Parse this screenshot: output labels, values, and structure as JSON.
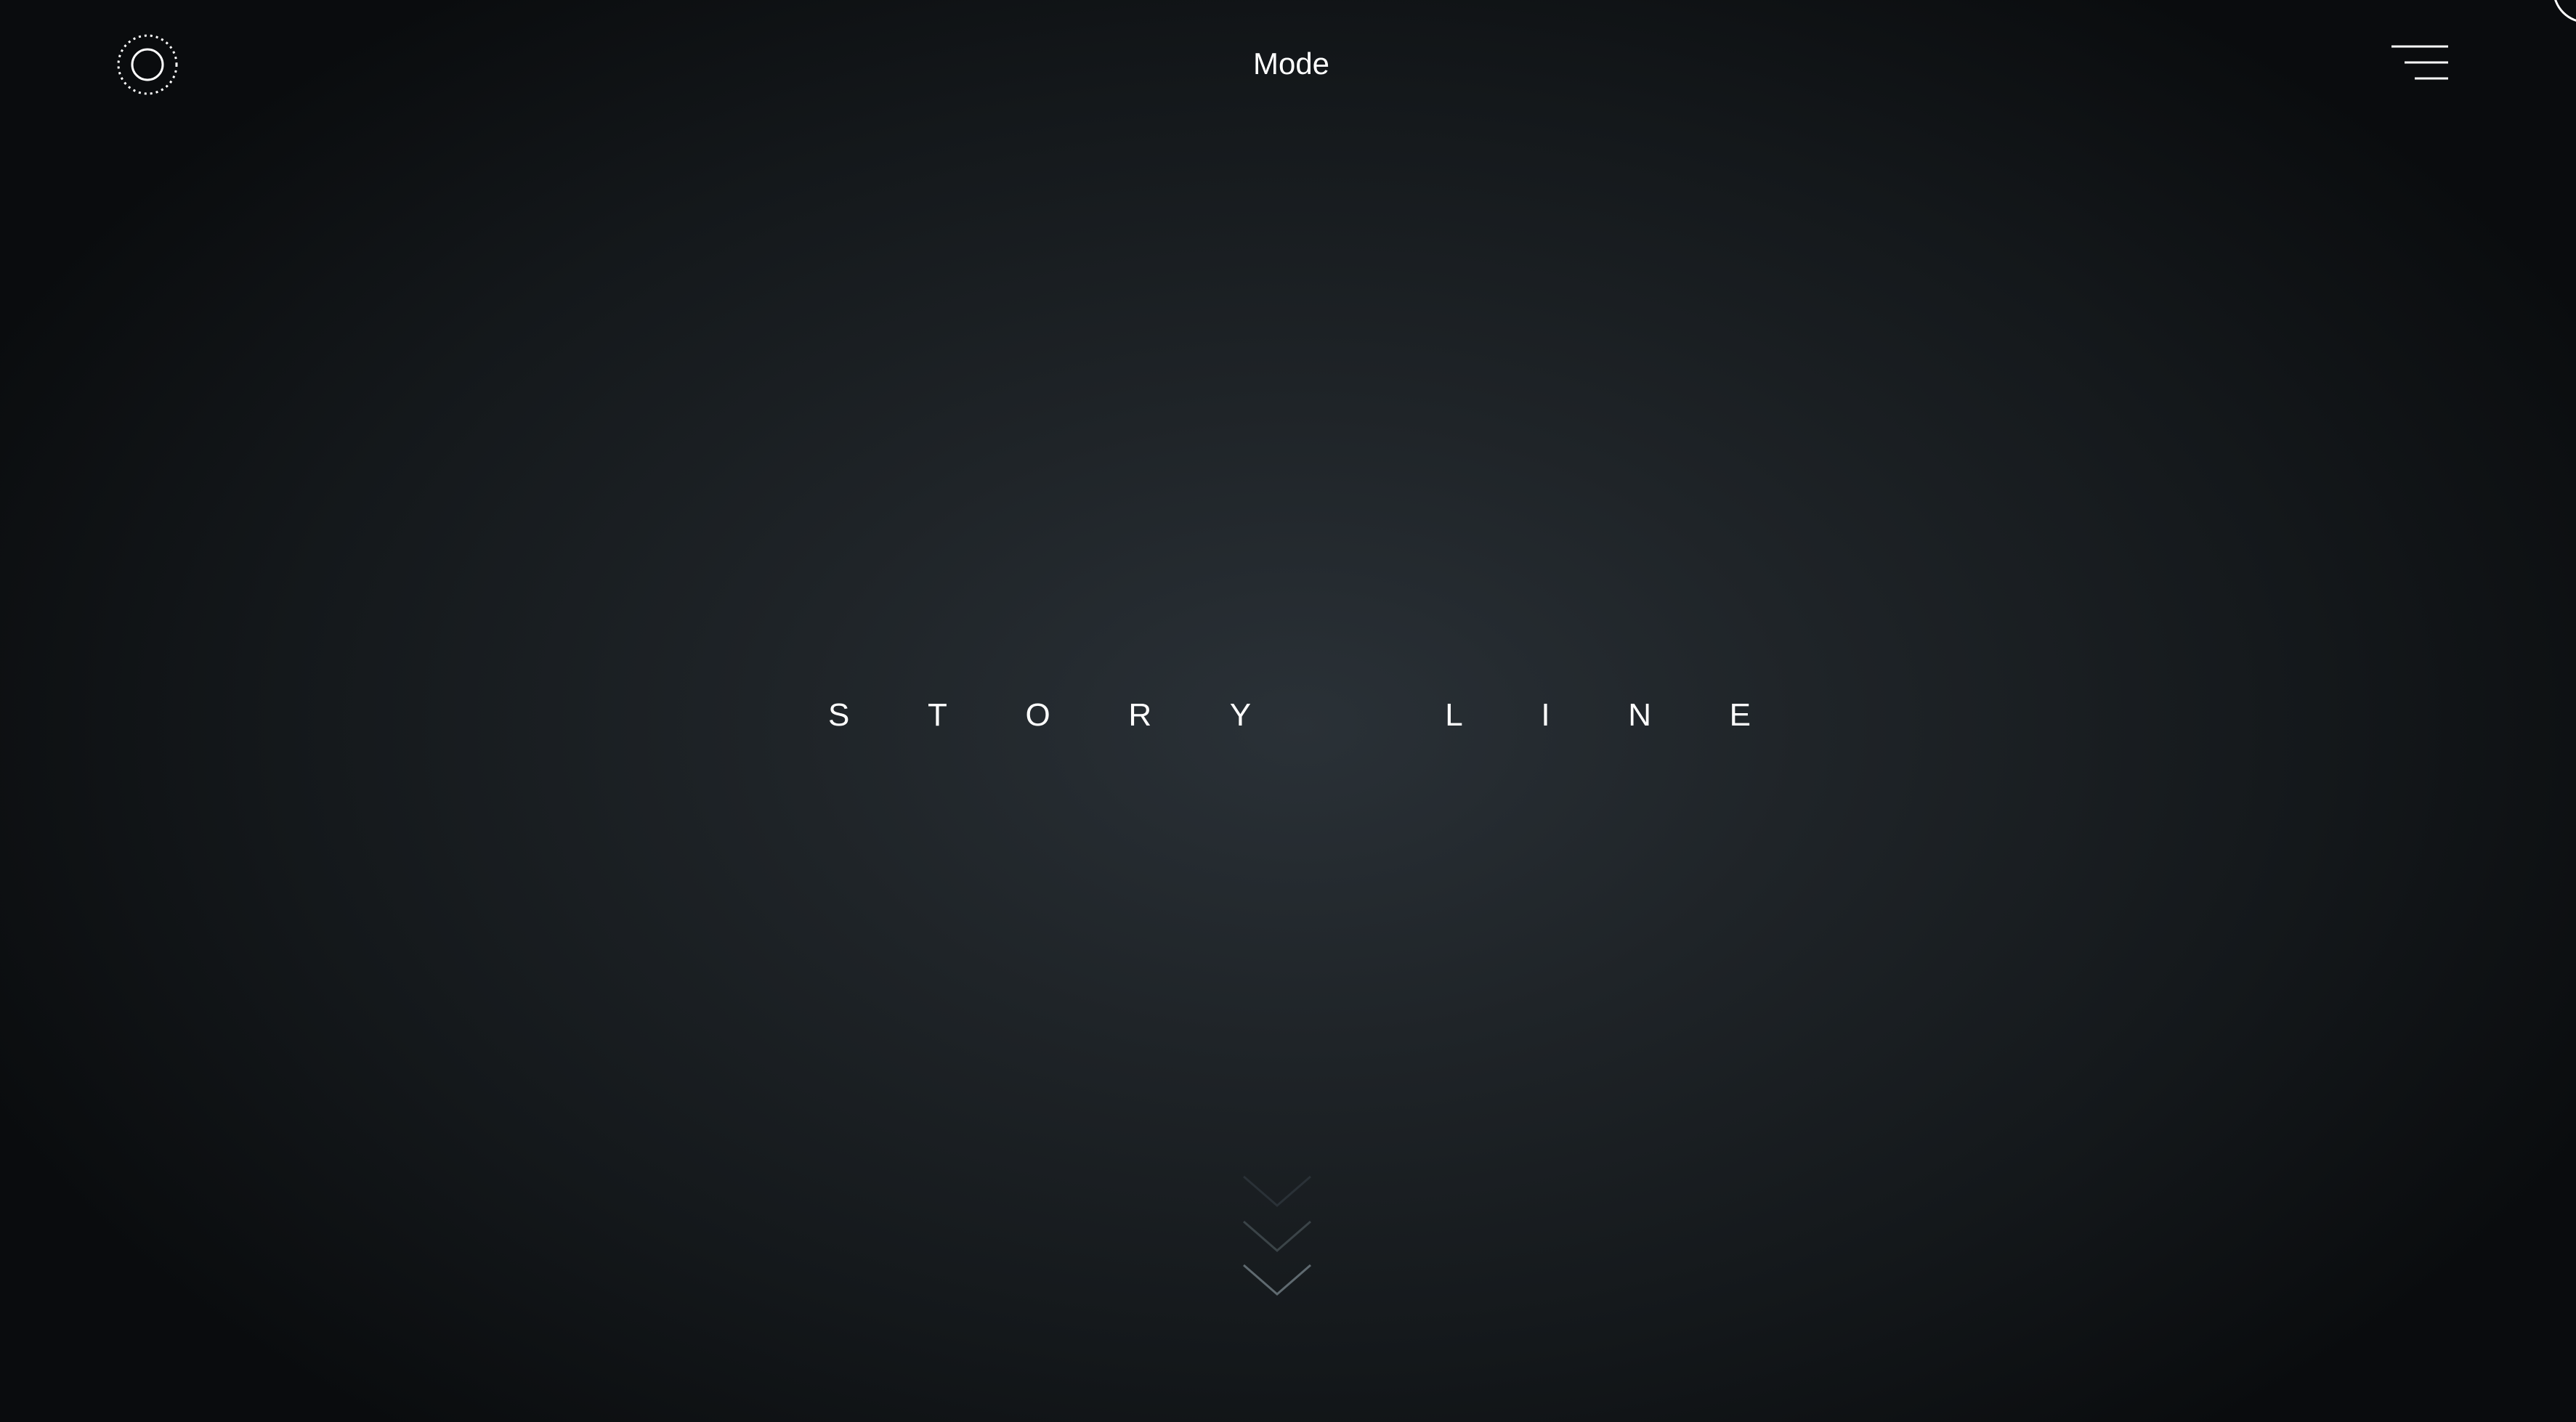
{
  "header": {
    "title": "Mode",
    "logo_icon": "dotted-circle-logo-icon",
    "menu_icon": "hamburger-menu-icon"
  },
  "hero": {
    "title_letters": [
      "S",
      "T",
      "O",
      "R",
      "Y",
      "",
      "L",
      "I",
      "N",
      "E"
    ]
  },
  "scroll_indicator": {
    "icon": "chevron-down-icon",
    "count": 3
  },
  "colors": {
    "background_center": "#2a3137",
    "background_edge": "#0a0c0e",
    "text": "#ffffff",
    "chevron": "#5f6a70"
  }
}
